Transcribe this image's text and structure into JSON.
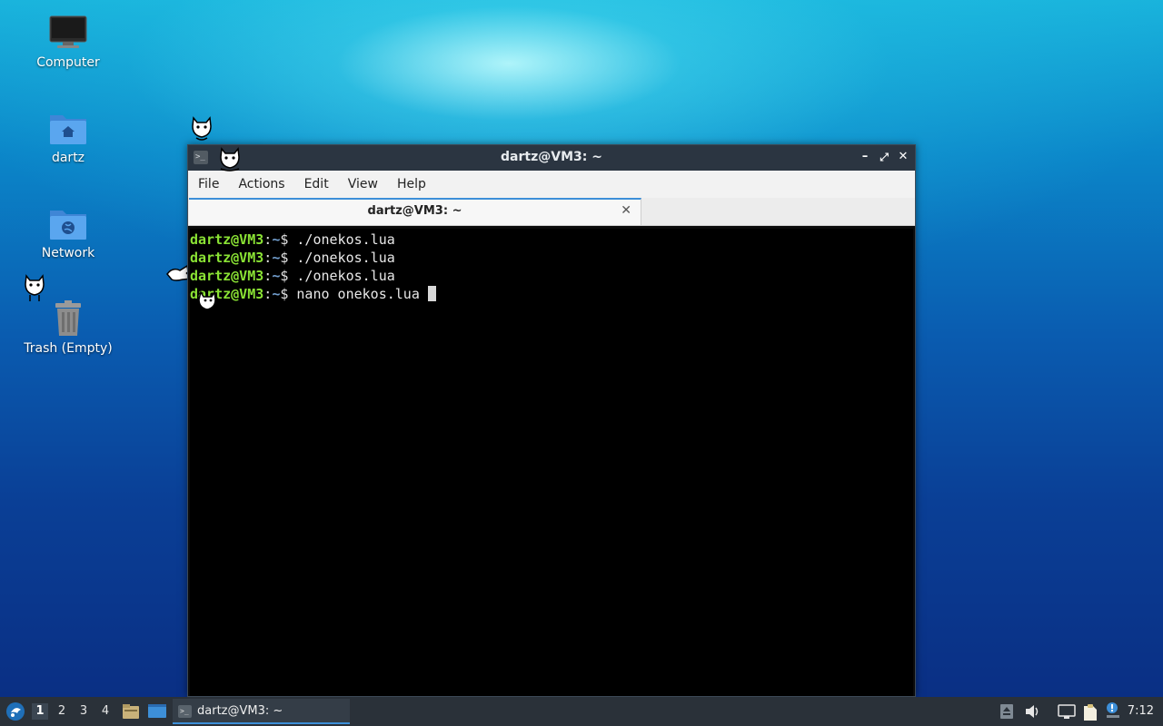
{
  "desktop": {
    "icons": [
      {
        "label": "Computer",
        "icon": "monitor-icon"
      },
      {
        "label": "dartz",
        "icon": "home-folder-icon"
      },
      {
        "label": "Network",
        "icon": "network-folder-icon"
      },
      {
        "label": "Trash (Empty)",
        "icon": "trash-icon"
      }
    ]
  },
  "terminal": {
    "window_title": "dartz@VM3: ~",
    "menu": [
      "File",
      "Actions",
      "Edit",
      "View",
      "Help"
    ],
    "tab_title": "dartz@VM3: ~",
    "prompt_user": "dartz@VM3",
    "prompt_path": "~",
    "lines": [
      {
        "cmd": "./onekos.lua"
      },
      {
        "cmd": "./onekos.lua"
      },
      {
        "cmd": "./onekos.lua"
      },
      {
        "cmd": "nano onekos.lua"
      }
    ]
  },
  "taskbar": {
    "workspaces": [
      "1",
      "2",
      "3",
      "4"
    ],
    "active_workspace": "1",
    "task_title": "dartz@VM3: ~",
    "clock": "7:12"
  },
  "colors": {
    "prompt_user": "#8ae234",
    "prompt_path": "#729fcf",
    "accent": "#3d8fd8",
    "titlebar": "#2b3541",
    "taskbar": "#2a3139"
  }
}
